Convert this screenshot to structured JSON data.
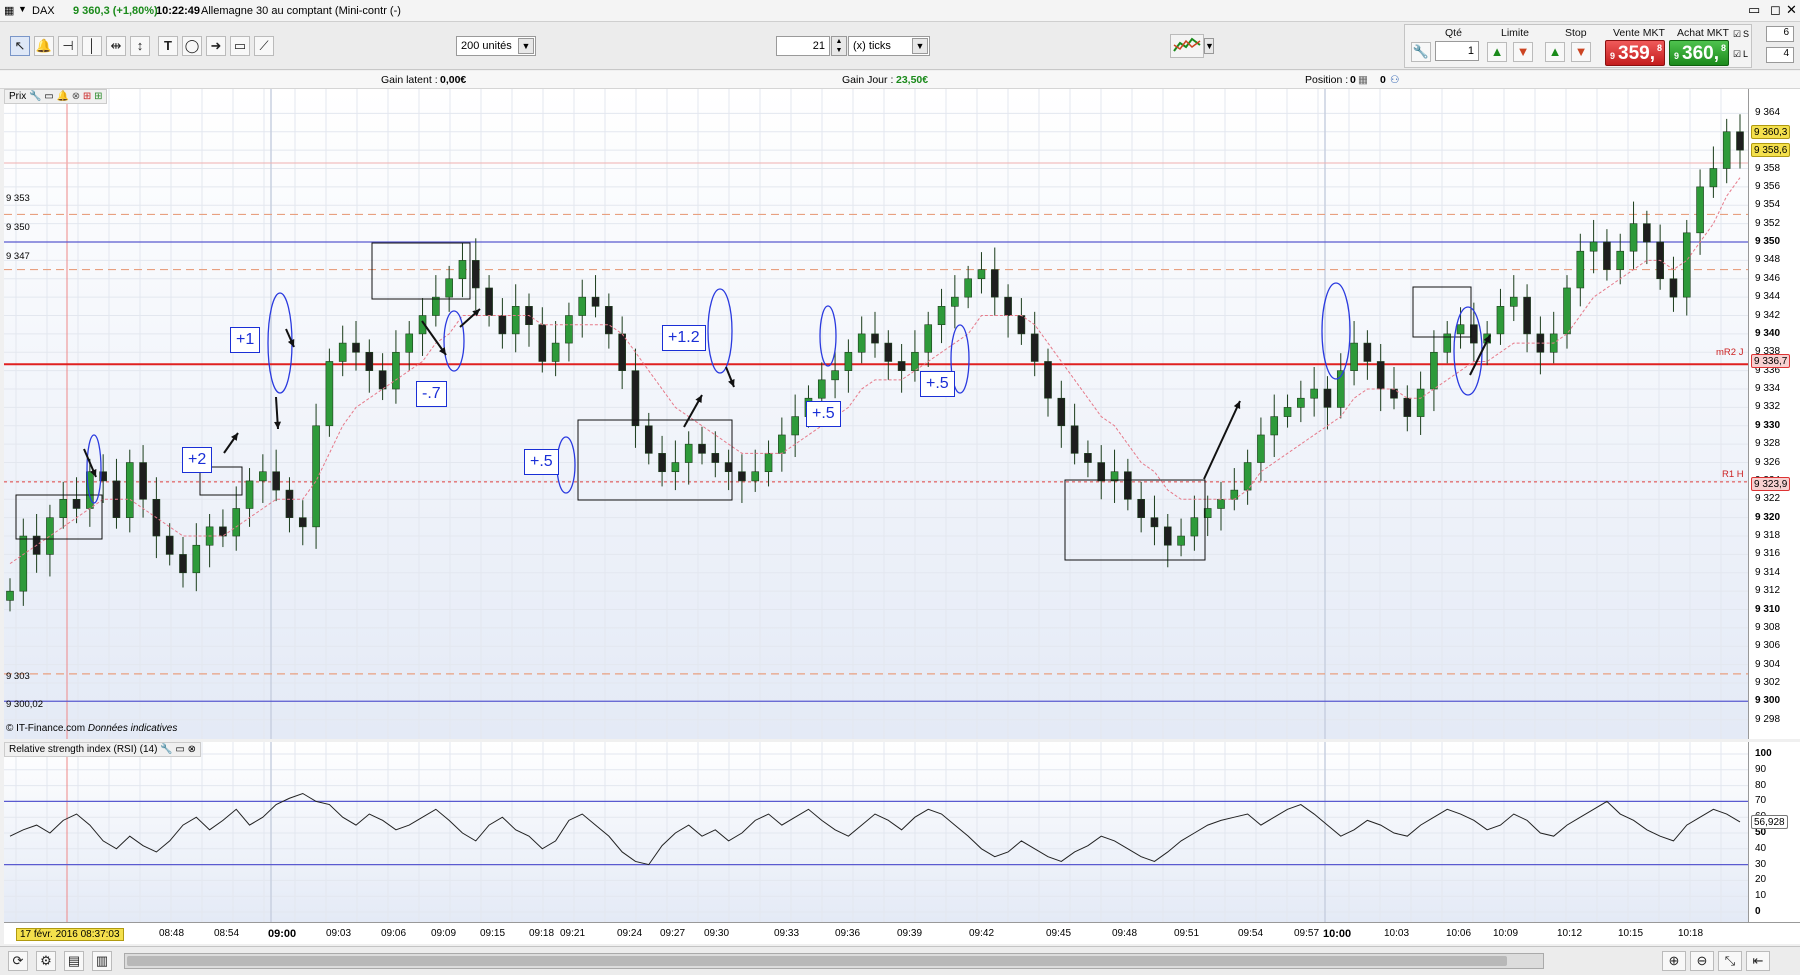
{
  "titlebar": {
    "symbol": "DAX",
    "price_change": "9 360,3 (+1,80%)",
    "time": "10:22:49",
    "instrument": "Allemagne 30 au comptant (Mini-contr (-)"
  },
  "toolbar": {
    "units_select": "200 unités",
    "ticks_value": "21",
    "ticks_label": "(x) ticks"
  },
  "order_panel": {
    "qty_label": "Qté",
    "qty_value": "1",
    "limit_label": "Limite",
    "stop_label": "Stop",
    "sell_label": "Vente MKT",
    "buy_label": "Achat MKT",
    "sell_price_prefix": "9",
    "sell_price_main": "359,",
    "sell_price_sup": "8",
    "buy_price_prefix": "9",
    "buy_price_main": "360,",
    "buy_price_sup": "8",
    "s_label": "S",
    "s_value": "6",
    "l_label": "L",
    "l_value": "4"
  },
  "infobar": {
    "gain_latent_label": "Gain latent :",
    "gain_latent_value": "0,00€",
    "gain_jour_label": "Gain Jour :",
    "gain_jour_value": "23,50€",
    "position_label": "Position :",
    "position_value1": "0",
    "position_value2": "0"
  },
  "main_panel": {
    "header": "Prix",
    "copyright": "© IT-Finance.com",
    "copyright_note": "Données indicatives",
    "left_levels": [
      "9 353",
      "9 350",
      "9 347",
      "9 303",
      "9 300,02"
    ],
    "pivot_r2": "mR2 J",
    "pivot_r1": "R1 H",
    "annotations": [
      "+1",
      "+2",
      "-.7",
      "+.5",
      "+1.2",
      "+.5",
      "+.5"
    ]
  },
  "price_axis": {
    "labels": [
      "9 364",
      "9 362",
      "9 360",
      "9 358",
      "9 356",
      "9 354",
      "9 352",
      "9 350",
      "9 348",
      "9 346",
      "9 344",
      "9 342",
      "9 340",
      "9 338",
      "9 336",
      "9 334",
      "9 332",
      "9 330",
      "9 328",
      "9 326",
      "9 324",
      "9 322",
      "9 320",
      "9 318",
      "9 316",
      "9 314",
      "9 312",
      "9 310",
      "9 308",
      "9 306",
      "9 304",
      "9 302",
      "9 300",
      "9 298"
    ],
    "tag_current": "9 360,3",
    "tag_prev": "9 358,6",
    "tag_r2": "9 336,7",
    "tag_r1": "9 323,9"
  },
  "rsi_panel": {
    "header": "Relative strength index (RSI) (14)",
    "axis_labels": [
      "100",
      "90",
      "80",
      "70",
      "60",
      "50",
      "40",
      "30",
      "20",
      "10",
      "0"
    ],
    "current_value": "56,928"
  },
  "time_axis": {
    "cursor_label": "17 févr. 2016 08:37:03",
    "labels": [
      "08:48",
      "08:54",
      "09:00",
      "09:03",
      "09:06",
      "09:09",
      "09:15",
      "09:18",
      "09:21",
      "09:24",
      "09:27",
      "09:30",
      "09:33",
      "09:36",
      "09:39",
      "09:42",
      "09:45",
      "09:48",
      "09:51",
      "09:54",
      "09:57",
      "10:00",
      "10:03",
      "10:06",
      "10:09",
      "10:12",
      "10:15",
      "10:18"
    ]
  },
  "chart_data": {
    "type": "candlestick",
    "y_range": [
      9297,
      9366
    ],
    "series": [
      {
        "name": "Prix",
        "values": [
          9312,
          9318,
          9316,
          9320,
          9322,
          9321,
          9325,
          9324,
          9320,
          9326,
          9322,
          9318,
          9316,
          9314,
          9317,
          9319,
          9318,
          9321,
          9324,
          9325,
          9323,
          9320,
          9319,
          9330,
          9337,
          9339,
          9338,
          9336,
          9334,
          9338,
          9340,
          9342,
          9344,
          9346,
          9348,
          9345,
          9342,
          9340,
          9343,
          9341,
          9337,
          9339,
          9342,
          9344,
          9343,
          9340,
          9336,
          9330,
          9327,
          9325,
          9326,
          9328,
          9327,
          9326,
          9325,
          9324,
          9325,
          9327,
          9329,
          9331,
          9333,
          9335,
          9336,
          9338,
          9340,
          9339,
          9337,
          9336,
          9338,
          9341,
          9343,
          9344,
          9346,
          9347,
          9344,
          9342,
          9340,
          9337,
          9333,
          9330,
          9327,
          9326,
          9324,
          9325,
          9322,
          9320,
          9319,
          9317,
          9318,
          9320,
          9321,
          9322,
          9323,
          9326,
          9329,
          9331,
          9332,
          9333,
          9334,
          9332,
          9336,
          9339,
          9337,
          9334,
          9333,
          9331,
          9334,
          9338,
          9340,
          9341,
          9339,
          9340,
          9343,
          9344,
          9340,
          9338,
          9340,
          9345,
          9349,
          9350,
          9347,
          9349,
          9352,
          9350,
          9346,
          9344,
          9351,
          9356,
          9358,
          9362,
          9360
        ]
      },
      {
        "name": "Moyenne",
        "values": [
          9315,
          9316,
          9317,
          9318,
          9319,
          9320,
          9321,
          9322,
          9322,
          9322,
          9321,
          9320,
          9319,
          9318,
          9318,
          9318,
          9318,
          9319,
          9320,
          9321,
          9322,
          9322,
          9322,
          9324,
          9327,
          9330,
          9332,
          9333,
          9334,
          9335,
          9336,
          9337,
          9339,
          9340,
          9342,
          9342,
          9342,
          9342,
          9342,
          9342,
          9341,
          9341,
          9341,
          9341,
          9341,
          9341,
          9340,
          9338,
          9336,
          9334,
          9332,
          9331,
          9330,
          9329,
          9328,
          9327,
          9327,
          9327,
          9327,
          9328,
          9329,
          9330,
          9331,
          9332,
          9334,
          9335,
          9335,
          9335,
          9336,
          9337,
          9338,
          9339,
          9340,
          9342,
          9342,
          9342,
          9342,
          9341,
          9339,
          9337,
          9335,
          9333,
          9331,
          9330,
          9328,
          9326,
          9325,
          9323,
          9322,
          9322,
          9322,
          9322,
          9322,
          9323,
          9325,
          9326,
          9327,
          9328,
          9329,
          9330,
          9331,
          9333,
          9334,
          9334,
          9334,
          9333,
          9333,
          9334,
          9335,
          9336,
          9337,
          9337,
          9338,
          9339,
          9339,
          9339,
          9339,
          9340,
          9342,
          9344,
          9345,
          9346,
          9347,
          9348,
          9348,
          9347,
          9348,
          9350,
          9352,
          9355,
          9357
        ]
      }
    ],
    "horizontal_levels": [
      9353,
      9350,
      9347,
      9336.7,
      9323.9,
      9303,
      9300.02,
      9358.6
    ],
    "rsi_levels": [
      70,
      30
    ],
    "rsi_values": [
      48,
      52,
      55,
      50,
      58,
      62,
      55,
      45,
      40,
      48,
      42,
      38,
      45,
      55,
      60,
      52,
      58,
      65,
      55,
      60,
      68,
      72,
      75,
      70,
      68,
      60,
      55,
      62,
      58,
      52,
      55,
      60,
      65,
      58,
      50,
      45,
      55,
      60,
      52,
      48,
      40,
      45,
      58,
      62,
      55,
      48,
      38,
      32,
      30,
      42,
      50,
      55,
      48,
      52,
      45,
      50,
      58,
      62,
      55,
      60,
      65,
      58,
      52,
      48,
      55,
      62,
      58,
      52,
      60,
      65,
      62,
      55,
      48,
      40,
      35,
      38,
      45,
      40,
      35,
      32,
      38,
      42,
      48,
      45,
      40,
      35,
      32,
      38,
      45,
      50,
      55,
      58,
      60,
      62,
      55,
      60,
      65,
      68,
      62,
      55,
      48,
      52,
      58,
      55,
      50,
      48,
      55,
      60,
      65,
      62,
      58,
      52,
      55,
      62,
      58,
      50,
      48,
      55,
      60,
      65,
      70,
      62,
      58,
      52,
      48,
      45,
      55,
      60,
      65,
      62,
      57
    ]
  }
}
